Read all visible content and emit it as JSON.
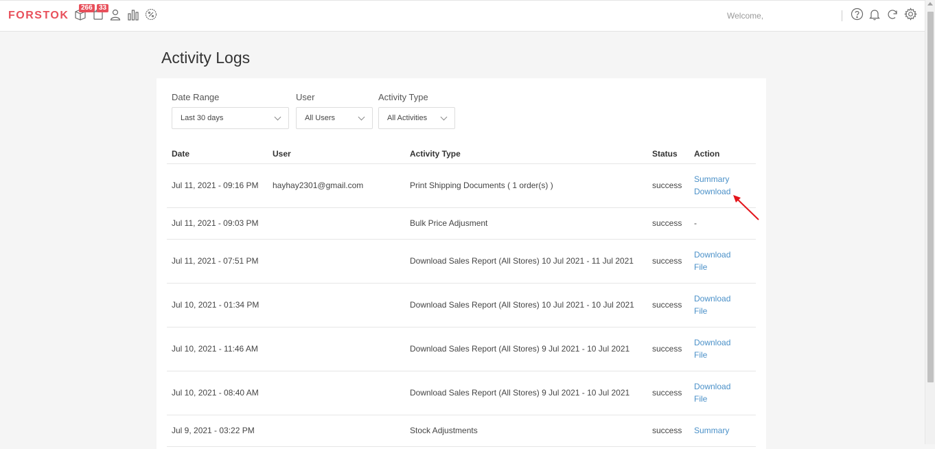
{
  "header": {
    "logo": "FORSTOK",
    "badges": {
      "products": "266",
      "orders": "33"
    },
    "welcome": "Welcome,",
    "icons": [
      "box-icon",
      "bag-icon",
      "user-icon",
      "chart-icon",
      "promo-icon",
      "help-icon",
      "bell-icon",
      "sync-icon",
      "gear-icon"
    ]
  },
  "page": {
    "title": "Activity Logs"
  },
  "filters": {
    "date_range": {
      "label": "Date Range",
      "value": "Last 30 days"
    },
    "user": {
      "label": "User",
      "value": "All Users"
    },
    "activity_type": {
      "label": "Activity Type",
      "value": "All Activities"
    }
  },
  "table": {
    "headers": {
      "date": "Date",
      "user": "User",
      "activity_type": "Activity Type",
      "status": "Status",
      "action": "Action"
    },
    "rows": [
      {
        "date": "Jul 11, 2021 - 09:16 PM",
        "user": "hayhay2301@gmail.com",
        "activity": "Print Shipping Documents ( 1 order(s) )",
        "status": "success",
        "actions": [
          "Summary",
          "Download"
        ]
      },
      {
        "date": "Jul 11, 2021 - 09:03 PM",
        "user": "",
        "activity": "Bulk Price Adjusment",
        "status": "success",
        "actions": [
          "-"
        ]
      },
      {
        "date": "Jul 11, 2021 - 07:51 PM",
        "user": "",
        "activity": "Download Sales Report (All Stores) 10 Jul 2021 - 11 Jul 2021",
        "status": "success",
        "actions": [
          "Download",
          "File"
        ]
      },
      {
        "date": "Jul 10, 2021 - 01:34 PM",
        "user": "",
        "activity": "Download Sales Report (All Stores) 10 Jul 2021 - 10 Jul 2021",
        "status": "success",
        "actions": [
          "Download",
          "File"
        ]
      },
      {
        "date": "Jul 10, 2021 - 11:46 AM",
        "user": "",
        "activity": "Download Sales Report (All Stores) 9 Jul 2021 - 10 Jul 2021",
        "status": "success",
        "actions": [
          "Download",
          "File"
        ]
      },
      {
        "date": "Jul 10, 2021 - 08:40 AM",
        "user": "",
        "activity": "Download Sales Report (All Stores) 9 Jul 2021 - 10 Jul 2021",
        "status": "success",
        "actions": [
          "Download",
          "File"
        ]
      },
      {
        "date": "Jul 9, 2021 - 03:22 PM",
        "user": "",
        "activity": "Stock Adjustments",
        "status": "success",
        "actions": [
          "Summary"
        ]
      }
    ]
  },
  "colors": {
    "brand": "#e8505b",
    "link": "#4a90c8",
    "success": "#3cb54a",
    "annotation_arrow": "#e3141b"
  }
}
